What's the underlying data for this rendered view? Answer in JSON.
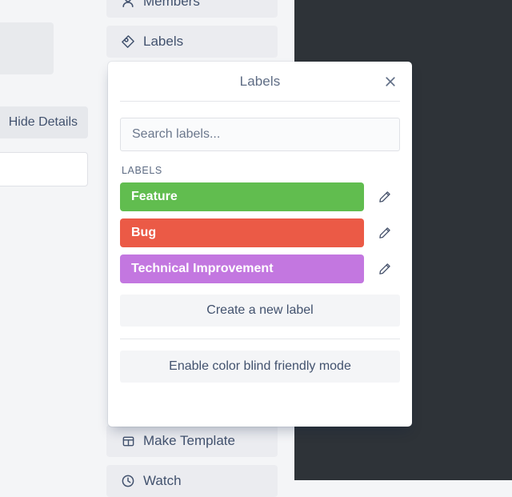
{
  "background": {
    "hide_details_label": "Hide Details",
    "sidebar_items": [
      {
        "label": "Members",
        "icon": "person-icon"
      },
      {
        "label": "Labels",
        "icon": "tag-icon"
      },
      {
        "label": "Make Template",
        "icon": "template-icon"
      },
      {
        "label": "Watch",
        "icon": "watch-icon"
      }
    ]
  },
  "popover": {
    "title": "Labels",
    "close_icon": "close-icon",
    "search": {
      "value": "",
      "placeholder": "Search labels..."
    },
    "section_header": "LABELS",
    "labels": [
      {
        "name": "Feature",
        "color": "#61BD4F",
        "edit_icon": "pencil-icon"
      },
      {
        "name": "Bug",
        "color": "#EB5A46",
        "edit_icon": "pencil-icon"
      },
      {
        "name": "Technical Improvement",
        "color": "#C377E0",
        "edit_icon": "pencil-icon"
      }
    ],
    "create_label_button": "Create a new label",
    "color_blind_button": "Enable color blind friendly mode"
  }
}
